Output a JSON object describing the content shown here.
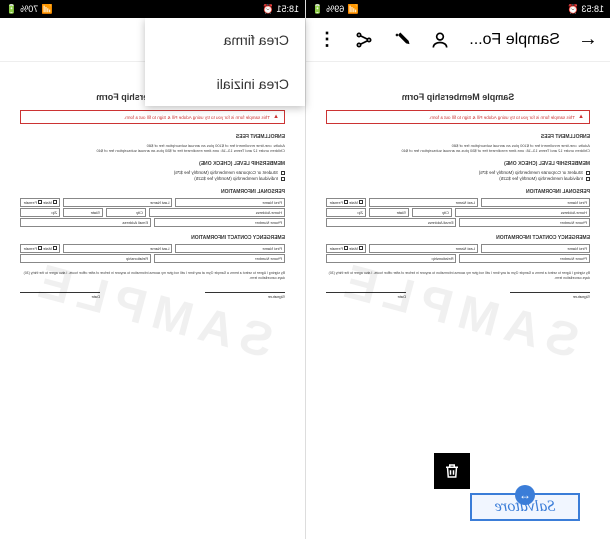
{
  "statusBar": {
    "time_left": "18:53",
    "time_right": "18:51",
    "battery_left": "69%",
    "battery_right": "70%"
  },
  "appBar": {
    "title": "Sample Fo..."
  },
  "menu": {
    "item1": "Crea firma",
    "item2": "Crea iniziali"
  },
  "document": {
    "watermark": "SAMPLE",
    "title": "Sample Membership Form",
    "alert": "This sample form is for you to try using Adobe Fill & Sign to fill out a form.",
    "fees_title": "ENROLLMENT FEES",
    "fees_line1": "Adults: one-time enrollment fee of $100 plus an annual subscription fee of $80",
    "fees_line2": "Children under 12 and Teens 13–18: one-time enrollment fee of $50 plus an annual subscription fee of $40",
    "level_title": "MEMBERSHIP LEVEL (CHECK ONE)",
    "level_opt1": "Student or Corporate membership (Monthly fee $75)",
    "level_opt2": "Individual membership (Monthly fee $125)",
    "personal_title": "PERSONAL INFORMATION",
    "field_first": "First Name",
    "field_last": "Last Name",
    "field_male": "Male",
    "field_female": "Female",
    "field_email": "Home Address",
    "field_city": "City",
    "field_state": "State",
    "field_zip": "Zip",
    "field_phone": "Phone Number",
    "field_email2": "Email Address",
    "emergency_title": "EMERGENCY CONTACT INFORMATION",
    "field_relationship": "Relationship",
    "agreement": "By signing I Agree to select a terms a Sample Gym at any time I will not give my access information to anyone in before of after office hours. I also agree to the thirty (30) days cancellation term.",
    "sig_label": "Signature",
    "date_label": "Date"
  },
  "signature": {
    "text": "Salvatore"
  }
}
